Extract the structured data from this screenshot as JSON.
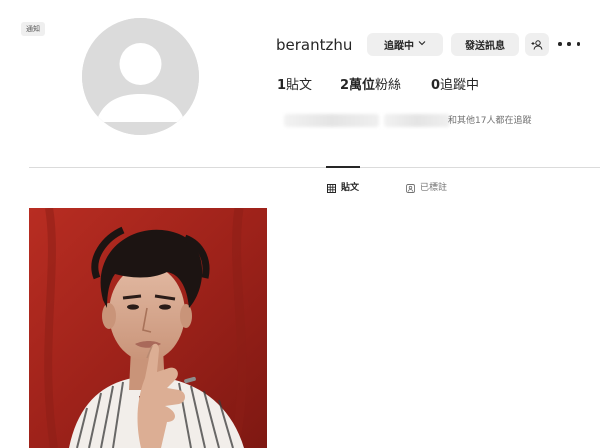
{
  "notice": {
    "label": "通知"
  },
  "profile": {
    "username": "berantzhu",
    "avatar_icon": "default-avatar-icon",
    "buttons": {
      "following_label": "追蹤中",
      "following_chevron": "⌵",
      "message_label": "發送訊息",
      "add_user_icon": "add-user-icon",
      "more_icon": "more-options-icon"
    },
    "stats": {
      "posts_count": "1",
      "posts_label": "貼文",
      "followers_count": "2萬位",
      "followers_label": "粉絲",
      "following_count": "0",
      "following_label": "追蹤中"
    },
    "followed_by_text": "和其他17人都在追蹤"
  },
  "tabs": [
    {
      "label": "貼文",
      "icon": "grid-icon",
      "active": true
    },
    {
      "label": "已標註",
      "icon": "tag-icon",
      "active": false
    }
  ],
  "posts": [
    {
      "thumbnail": "portrait-photo"
    }
  ],
  "colors": {
    "text": "#262626",
    "muted": "#737373",
    "button_bg": "#efefef",
    "divider": "#dbdbdb",
    "avatar_bg": "#dbdbdb",
    "photo_bg": "#a6261c"
  }
}
